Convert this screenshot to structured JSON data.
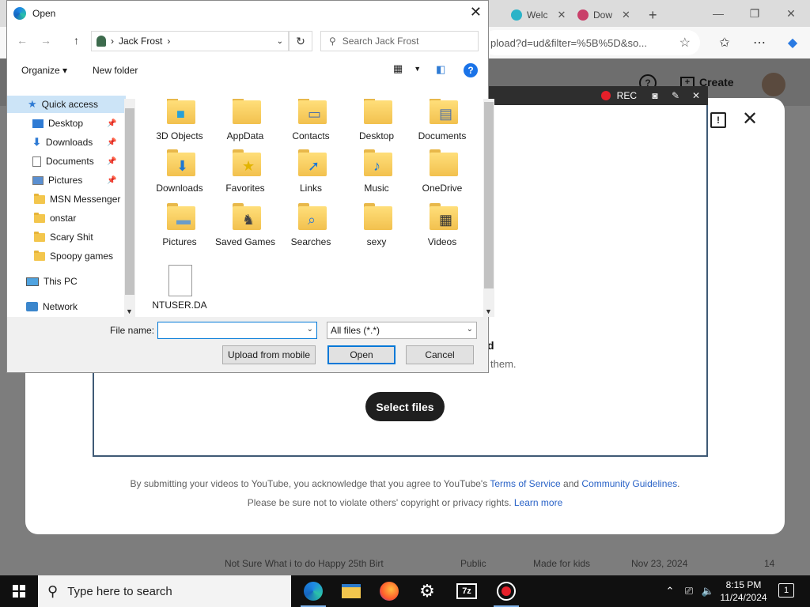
{
  "browser": {
    "tabs": [
      {
        "label": "Welc",
        "icon": "edge-icon"
      },
      {
        "label": "Dow",
        "icon": "opera-icon"
      }
    ],
    "new_tab": "+",
    "address": "pload?d=ud&filter=%5B%5D&so..."
  },
  "youtube": {
    "create_label": "Create",
    "drop_heading_fragment": "d",
    "drop_subtext_fragment": "them.",
    "select_files": "Select files",
    "legal_line1_prefix": "By submitting your videos to YouTube, you acknowledge that you agree to YouTube's ",
    "terms_link": "Terms of Service",
    "legal_and": " and ",
    "guidelines_link": "Community Guidelines",
    "legal_period": ".",
    "legal_line2_prefix": "Please be sure not to violate others' copyright or privacy rights. ",
    "learn_more": "Learn more",
    "row": {
      "title": "Not Sure What i to do Happy 25th Birt",
      "visibility": "Public",
      "audience": "Made for kids",
      "date": "Nov 23, 2024",
      "count": "14"
    }
  },
  "recorder": {
    "size": "772x439",
    "rec_label": "REC"
  },
  "dialog": {
    "title": "Open",
    "breadcrumb": [
      "Jack Frost"
    ],
    "search_placeholder": "Search Jack Frost",
    "organize": "Organize",
    "new_folder": "New folder",
    "nav": [
      {
        "label": "Quick access",
        "icon": "star",
        "selected": true
      },
      {
        "label": "Desktop",
        "icon": "blue",
        "pinned": true
      },
      {
        "label": "Downloads",
        "icon": "down",
        "pinned": true
      },
      {
        "label": "Documents",
        "icon": "doc",
        "pinned": true
      },
      {
        "label": "Pictures",
        "icon": "pic",
        "pinned": true
      },
      {
        "label": "MSN Messenger",
        "icon": "folder"
      },
      {
        "label": "onstar",
        "icon": "folder"
      },
      {
        "label": "Scary Shit",
        "icon": "folder"
      },
      {
        "label": "Spoopy games",
        "icon": "folder"
      },
      {
        "label": "This PC",
        "icon": "pc"
      },
      {
        "label": "Network",
        "icon": "net"
      }
    ],
    "files": [
      {
        "label": "3D Objects",
        "overlay": "■",
        "color": "#27a0d8"
      },
      {
        "label": "AppData",
        "overlay": "",
        "color": ""
      },
      {
        "label": "Contacts",
        "overlay": "▭",
        "color": "#4b6ea8"
      },
      {
        "label": "Desktop",
        "overlay": "",
        "color": ""
      },
      {
        "label": "Documents",
        "overlay": "▤",
        "color": "#4b6ea8"
      },
      {
        "label": "Downloads",
        "overlay": "⬇",
        "color": "#1e78d2"
      },
      {
        "label": "Favorites",
        "overlay": "★",
        "color": "#e2b400"
      },
      {
        "label": "Links",
        "overlay": "➚",
        "color": "#1e78d2"
      },
      {
        "label": "Music",
        "overlay": "♪",
        "color": "#1e78d2"
      },
      {
        "label": "OneDrive",
        "overlay": "",
        "color": ""
      },
      {
        "label": "Pictures",
        "overlay": "▬",
        "color": "#6a9cc9"
      },
      {
        "label": "Saved Games",
        "overlay": "♞",
        "color": "#444"
      },
      {
        "label": "Searches",
        "overlay": "⌕",
        "color": "#3d7cc9"
      },
      {
        "label": "sexy",
        "overlay": "",
        "color": ""
      },
      {
        "label": "Videos",
        "overlay": "▦",
        "color": "#333"
      },
      {
        "label": "NTUSER.DA",
        "overlay": "",
        "color": "",
        "page": true
      }
    ],
    "file_name_label": "File name:",
    "file_name_value": "",
    "file_type": "All files (*.*)",
    "upload_mobile": "Upload from mobile",
    "open": "Open",
    "cancel": "Cancel"
  },
  "taskbar": {
    "search_placeholder": "Type here to search",
    "time": "8:15 PM",
    "date": "11/24/2024",
    "notifications": "1",
    "apps": [
      "edge-icon",
      "file-explorer-icon",
      "firefox-icon",
      "settings-icon",
      "7zip-icon",
      "recorder-icon"
    ]
  }
}
